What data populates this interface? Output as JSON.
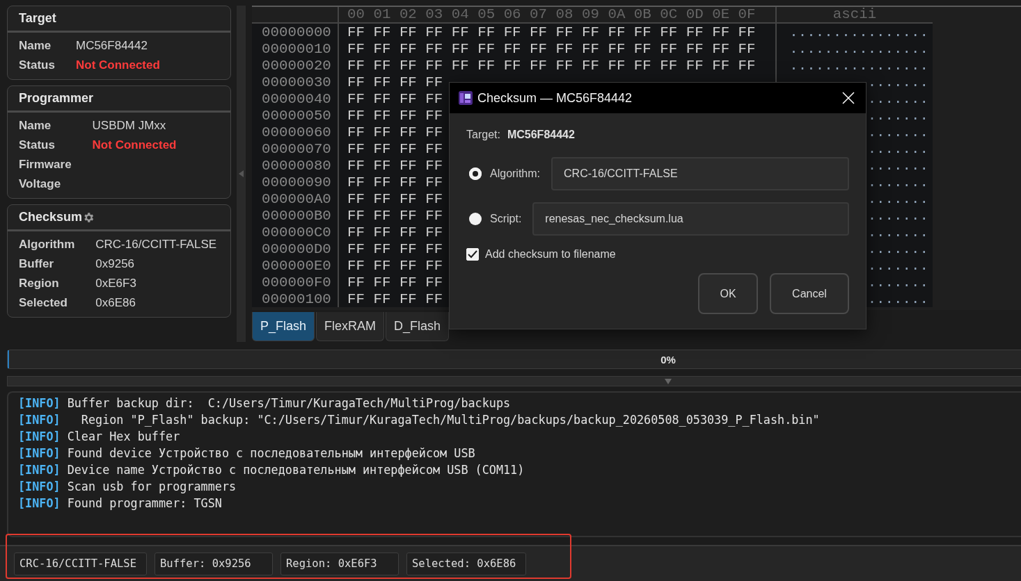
{
  "target": {
    "title": "Target",
    "fields": [
      {
        "label": "Name",
        "value": "MC56F84442",
        "kind": "plain"
      },
      {
        "label": "Status",
        "value": "Not Connected",
        "kind": "error"
      }
    ]
  },
  "programmer": {
    "title": "Programmer",
    "fields": [
      {
        "label": "Name",
        "value": "USBDM JMxx",
        "kind": "plain"
      },
      {
        "label": "Status",
        "value": "Not Connected",
        "kind": "error"
      },
      {
        "label": "Firmware"
      },
      {
        "label": "Voltage"
      }
    ]
  },
  "checksum": {
    "title": "Checksum",
    "fields": [
      {
        "label": "Algorithm",
        "value": "CRC-16/CCITT-FALSE",
        "kind": "plain"
      },
      {
        "label": "Buffer",
        "value": "0x9256",
        "kind": "plain"
      },
      {
        "label": "Region",
        "value": "0xE6F3",
        "kind": "plain"
      },
      {
        "label": "Selected",
        "value": "0x6E86",
        "kind": "plain"
      }
    ]
  },
  "hex_view": {
    "columns": [
      "00",
      "01",
      "02",
      "03",
      "04",
      "05",
      "06",
      "07",
      "08",
      "09",
      "0A",
      "0B",
      "0C",
      "0D",
      "0E",
      "0F"
    ],
    "ascii_header": "ascii",
    "rows": [
      {
        "address": "00000000",
        "bytes": [
          "FF",
          "FF",
          "FF",
          "FF",
          "FF",
          "FF",
          "FF",
          "FF",
          "FF",
          "FF",
          "FF",
          "FF",
          "FF",
          "FF",
          "FF",
          "FF"
        ],
        "ascii": "................"
      },
      {
        "address": "00000010",
        "bytes": [
          "FF",
          "FF",
          "FF",
          "FF",
          "FF",
          "FF",
          "FF",
          "FF",
          "FF",
          "FF",
          "FF",
          "FF",
          "FF",
          "FF",
          "FF",
          "FF"
        ],
        "ascii": "................"
      },
      {
        "address": "00000020",
        "bytes": [
          "FF",
          "FF",
          "FF",
          "FF",
          "FF",
          "FF",
          "FF",
          "FF",
          "FF",
          "FF",
          "FF",
          "FF",
          "FF",
          "FF",
          "FF",
          "FF"
        ],
        "ascii": "................"
      },
      {
        "address": "00000030",
        "bytes": [
          "FF",
          "FF",
          "FF",
          "FF"
        ],
        "ascii": "......."
      },
      {
        "address": "00000040",
        "bytes": [
          "FF",
          "FF",
          "FF",
          "FF"
        ],
        "ascii": "......."
      },
      {
        "address": "00000050",
        "bytes": [
          "FF",
          "FF",
          "FF",
          "FF"
        ],
        "ascii": "......."
      },
      {
        "address": "00000060",
        "bytes": [
          "FF",
          "FF",
          "FF",
          "FF"
        ],
        "ascii": "......."
      },
      {
        "address": "00000070",
        "bytes": [
          "FF",
          "FF",
          "FF",
          "FF"
        ],
        "ascii": "......."
      },
      {
        "address": "00000080",
        "bytes": [
          "FF",
          "FF",
          "FF",
          "FF"
        ],
        "ascii": "......."
      },
      {
        "address": "00000090",
        "bytes": [
          "FF",
          "FF",
          "FF",
          "FF"
        ],
        "ascii": "......."
      },
      {
        "address": "000000A0",
        "bytes": [
          "FF",
          "FF",
          "FF",
          "FF"
        ],
        "ascii": "......."
      },
      {
        "address": "000000B0",
        "bytes": [
          "FF",
          "FF",
          "FF",
          "FF"
        ],
        "ascii": "......."
      },
      {
        "address": "000000C0",
        "bytes": [
          "FF",
          "FF",
          "FF",
          "FF"
        ],
        "ascii": "......."
      },
      {
        "address": "000000D0",
        "bytes": [
          "FF",
          "FF",
          "FF",
          "FF"
        ],
        "ascii": "......."
      },
      {
        "address": "000000E0",
        "bytes": [
          "FF",
          "FF",
          "FF",
          "FF"
        ],
        "ascii": "......."
      },
      {
        "address": "000000F0",
        "bytes": [
          "FF",
          "FF",
          "FF",
          "FF"
        ],
        "ascii": "......."
      },
      {
        "address": "00000100",
        "bytes": [
          "FF",
          "FF",
          "FF",
          "FF"
        ],
        "ascii": "......."
      }
    ]
  },
  "tabs": [
    {
      "label": "P_Flash",
      "selected": true
    },
    {
      "label": "FlexRAM",
      "selected": false
    },
    {
      "label": "D_Flash",
      "selected": false
    }
  ],
  "progress": {
    "level": 0,
    "label": "0%"
  },
  "log": [
    {
      "tag": "[INFO]",
      "message": "Buffer backup dir:  C:/Users/Timur/KuragaTech/MultiProg/backups"
    },
    {
      "tag": "[INFO]",
      "message": "  Region \"P_Flash\" backup: \"C:/Users/Timur/KuragaTech/MultiProg/backups/backup_20260508_053039_P_Flash.bin\""
    },
    {
      "tag": "[INFO]",
      "message": "Clear Hex buffer"
    },
    {
      "tag": "[INFO]",
      "message": "Found device Устройство с последовательным интерфейсом USB"
    },
    {
      "tag": "[INFO]",
      "message": "Device name Устройство с последовательным интерфейсом USB (COM11)"
    },
    {
      "tag": "[INFO]",
      "message": "Scan usb for programmers"
    },
    {
      "tag": "[INFO]",
      "message": "Found programmer: TGSN"
    }
  ],
  "status_bar": [
    "CRC-16/CCITT-FALSE",
    "Buffer: 0x9256",
    "Region: 0xE6F3",
    "Selected: 0x6E86"
  ],
  "dialog": {
    "title": "Checksum — MC56F84442",
    "target_label": "Target:",
    "target_value": "MC56F84442",
    "options": [
      {
        "label": "Algorithm:",
        "value": "CRC-16/CCITT-FALSE",
        "selected": true
      },
      {
        "label": "Script:",
        "value": "renesas_nec_checksum.lua",
        "selected": false
      }
    ],
    "checkbox": {
      "label": "Add checksum to filename",
      "checked": true
    },
    "buttons": [
      "OK",
      "Cancel"
    ]
  }
}
